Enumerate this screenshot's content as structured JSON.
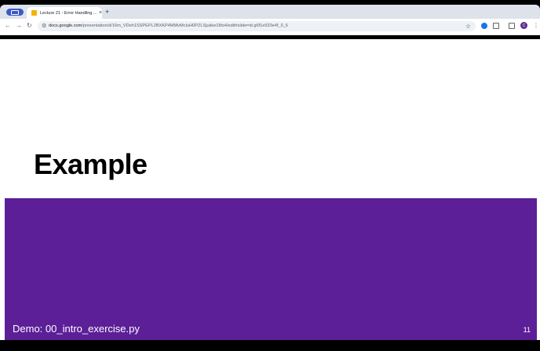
{
  "browser": {
    "tab": {
      "title": "Lecture 21 - Error Handling ...",
      "close_glyph": "×",
      "favicon": "slides-favicon-icon"
    },
    "new_tab_glyph": "+",
    "nav": {
      "back_glyph": "←",
      "forward_glyph": "→",
      "reload_glyph": "↻"
    },
    "address_bar": {
      "domain": "docs.google.com",
      "path": "/presentation/d/16m_VDeh1SSPEPL2BXKP4MMvMcIuH0PZLSjukke18ts4/edit#slide=id.g6f1e933e4f_0_6"
    },
    "star_glyph": "☆",
    "profile_initial": "C",
    "menu_glyph": "⋮",
    "colors": {
      "tabstrip": "#dee3eb",
      "tab_group": "#3c59c9",
      "omnibox": "#eef1f6"
    }
  },
  "slide": {
    "title": "Example",
    "demo_label": "Demo: 00_intro_exercise.py",
    "page_number": "11",
    "colors": {
      "band": "#5c1f98",
      "title": "#000000",
      "band_text": "#ffffff"
    }
  }
}
